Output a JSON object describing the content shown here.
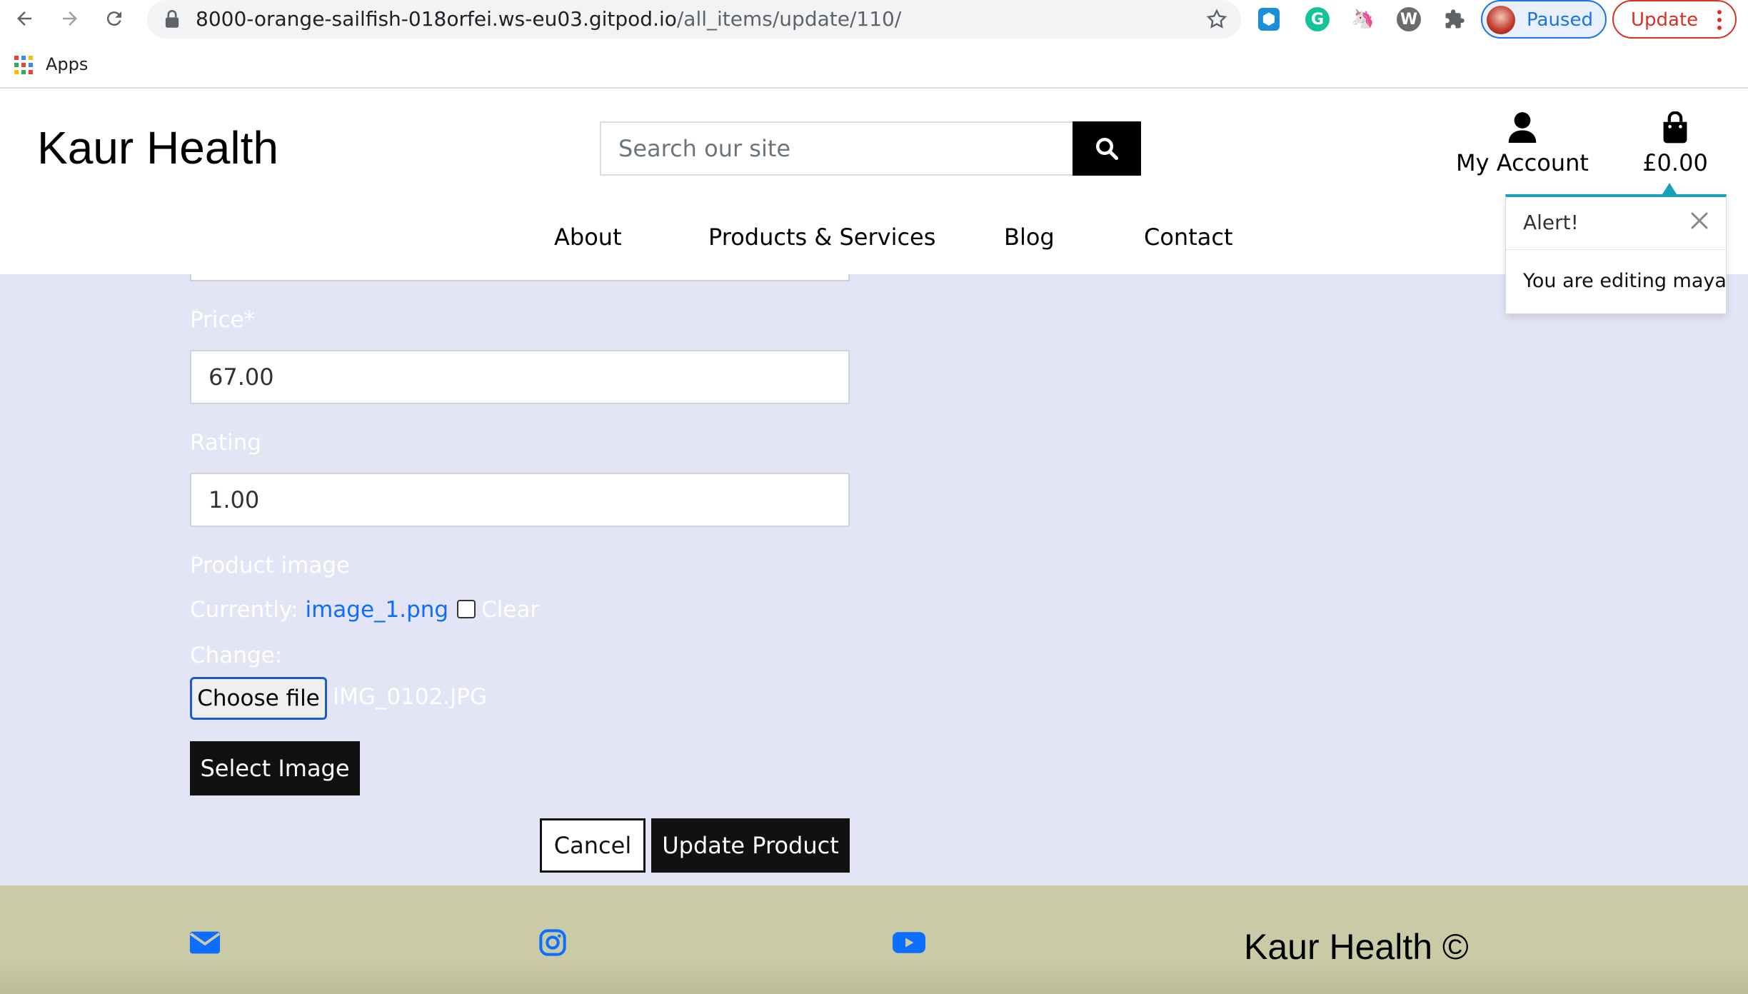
{
  "browser": {
    "url_host": "8000-orange-sailfish-018orfei.ws-eu03.gitpod.io",
    "url_path": "/all_items/update/110/",
    "profile_status": "Paused",
    "update_label": "Update",
    "bookmarks_apps_label": "Apps"
  },
  "header": {
    "logo": "Kaur Health",
    "search_placeholder": "Search our site",
    "account_label": "My Account",
    "bag_total": "£0.00"
  },
  "nav": {
    "items": [
      "About",
      "Products & Services",
      "Blog",
      "Contact"
    ]
  },
  "form": {
    "price_label": "Price*",
    "price_value": "67.00",
    "rating_label": "Rating",
    "rating_value": "1.00",
    "image_label": "Product image",
    "currently_label": "Currently:",
    "current_image": "image_1.png",
    "clear_label": "Clear",
    "change_label": "Change:",
    "choose_file_label": "Choose file",
    "file_name": "IMG_0102.JPG",
    "select_image_label": "Select Image",
    "cancel_label": "Cancel",
    "submit_label": "Update Product"
  },
  "alert": {
    "title": "Alert!",
    "message": "You are editing maya"
  },
  "footer": {
    "copyright": "Kaur Health ©",
    "icons": [
      "envelope-icon",
      "instagram-icon",
      "youtube-icon"
    ]
  },
  "colors": {
    "form_bg": "#e3e4f6",
    "footer_bg": "#c8cba6",
    "link_blue": "#0d6efd",
    "toast_accent": "#17a2b8"
  }
}
